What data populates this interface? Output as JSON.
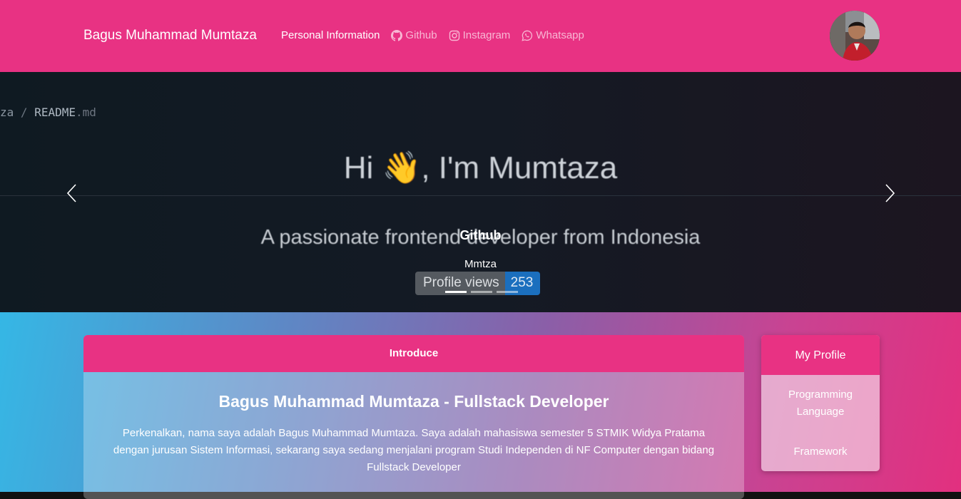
{
  "navbar": {
    "brand": "Bagus Muhammad Mumtaza",
    "links": [
      {
        "label": "Personal Information",
        "icon": null
      },
      {
        "label": "Github",
        "icon": "github-icon"
      },
      {
        "label": "Instagram",
        "icon": "instagram-icon"
      },
      {
        "label": "Whatsapp",
        "icon": "whatsapp-icon"
      }
    ],
    "accent": "#e83283"
  },
  "carousel": {
    "slide_path": {
      "prefix": "za",
      "separator": "/",
      "file": "README",
      "ext": ".md"
    },
    "hero_title_pre": "Hi ",
    "hero_emoji": "👋",
    "hero_title_post": ", I'm Mumtaza",
    "hero_subtitle": "A passionate frontend developer from Indonesia",
    "caption_title": "Github",
    "caption_subtitle": "Mmtza",
    "badge_label": "Profile views",
    "badge_count": "253",
    "active_slide": 1,
    "slide_count": 3
  },
  "intro": {
    "header": "Introduce",
    "title": "Bagus Muhammad Mumtaza - Fullstack Developer",
    "text": "Perkenalkan, nama saya adalah Bagus Muhammad Mumtaza. Saya adalah mahasiswa semester 5 STMIK Widya Pratama dengan jurusan Sistem Informasi, sekarang saya sedang menjalani program Studi Independen di NF Computer dengan bidang Fullstack Developer"
  },
  "profile": {
    "header": "My Profile",
    "items": [
      "Programming Language",
      "Framework"
    ]
  }
}
